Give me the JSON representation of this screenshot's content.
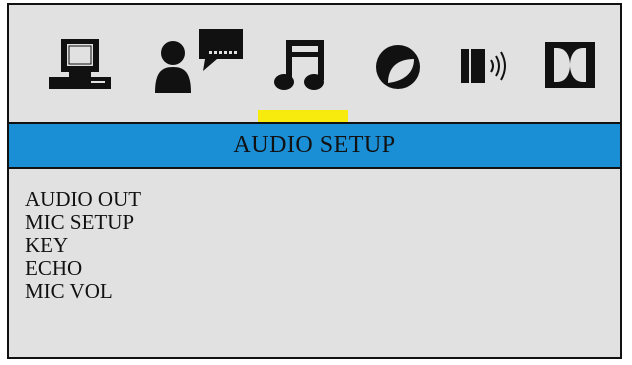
{
  "header": {
    "icons": [
      {
        "name": "monitor-icon",
        "label": "general setup"
      },
      {
        "name": "speaker-person-icon",
        "label": "speaker setup"
      },
      {
        "name": "music-note-icon",
        "label": "audio setup"
      },
      {
        "name": "video-icon",
        "label": "video setup"
      },
      {
        "name": "volume-icon",
        "label": "volume setup"
      },
      {
        "name": "dolby-icon",
        "label": "dolby setup"
      }
    ],
    "selected_index": 2
  },
  "title": "AUDIO SETUP",
  "menu": {
    "items": [
      "AUDIO OUT",
      "MIC SETUP",
      "KEY",
      "ECHO",
      "MIC VOL"
    ]
  },
  "colors": {
    "background": "#e1e1e1",
    "title_bar": "#1b8fd6",
    "highlight": "#f6eb0d",
    "ink": "#111111"
  }
}
